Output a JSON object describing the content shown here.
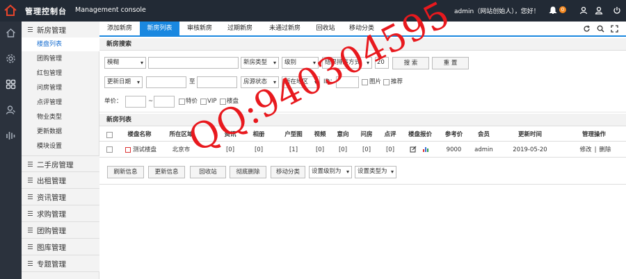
{
  "topbar": {
    "brand": "管理控制台",
    "brand_en": "Management console",
    "admin_text": "admin（网站创始人），您好！",
    "notification_count": "0",
    "icons": [
      "home-icon",
      "bell-icon",
      "user-icon",
      "user-alt-icon",
      "power-icon"
    ]
  },
  "rail": {
    "icons": [
      "home-icon",
      "gear-icon",
      "grid-icon",
      "user-icon",
      "bars-icon"
    ]
  },
  "sidebar": {
    "group_new_house": "新房管理",
    "sub_items": [
      "楼盘列表",
      "团购管理",
      "红包管理",
      "问房管理",
      "点评管理",
      "物业类型",
      "更新数据",
      "模块设置"
    ],
    "groups": [
      "二手房管理",
      "出租管理",
      "资讯管理",
      "求购管理",
      "团购管理",
      "图库管理",
      "专题管理"
    ]
  },
  "tabs": [
    "添加新房",
    "新房列表",
    "审核新房",
    "过期新房",
    "未通过新房",
    "回收站",
    "移动分类"
  ],
  "tab_active": "新房列表",
  "search": {
    "title": "新房搜索",
    "mode": "模糊",
    "keyword": "",
    "house_type": "新房类型",
    "level": "级别",
    "sort": "结果排序方式",
    "page_size": "20",
    "search_btn": "搜 索",
    "reset_btn": "重 置",
    "date_type": "更新日期",
    "date_to": "至",
    "house_status": "房源状态",
    "region": "所在地区",
    "id_label": "ID：",
    "cb_image": "图片",
    "cb_recommend": "推荐",
    "price_label": "单价：",
    "price_sep": "~",
    "cb_special": "特价",
    "cb_vip": "VIP",
    "cb_unit": "楼盘"
  },
  "list": {
    "title": "新房列表",
    "columns": [
      "楼盘名称",
      "所在区域",
      "资讯",
      "相册",
      "户型图",
      "视频",
      "意向",
      "问房",
      "点评",
      "楼盘报价",
      "参考价",
      "会员",
      "更新时间",
      "管理操作"
    ],
    "rows": [
      {
        "name": "测试楼盘",
        "region": "北京市",
        "news": "[0]",
        "album": "[0]",
        "layout": "[1]",
        "video": "[0]",
        "intent": "[0]",
        "ask": "[0]",
        "review": "[0]",
        "ref_price": "9000",
        "member": "admin",
        "updated": "2019-05-20",
        "edit": "修改",
        "sep": "|",
        "delete": "删除"
      }
    ],
    "actions": [
      "刷新信息",
      "更新信息",
      "回收站",
      "彻底删除",
      "移动分类",
      "设置级别为",
      "设置类型为"
    ]
  },
  "watermark": "QQ:940304595",
  "colors": {
    "accent": "#1a88e0",
    "topbar": "#222a35",
    "watermark": "#e8191e",
    "badge": "#f5881f"
  }
}
